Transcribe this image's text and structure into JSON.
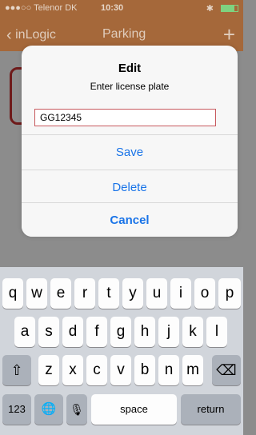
{
  "status_bar": {
    "carrier": "●●●○○ Telenor DK",
    "time": "10:30",
    "bluetooth": "bluetooth-icon",
    "battery": "battery-icon"
  },
  "nav": {
    "back_label": "inLogic",
    "title": "Parking",
    "add_label": "+"
  },
  "alert": {
    "title": "Edit",
    "message": "Enter license plate",
    "input_value": "GG12345",
    "buttons": {
      "save": "Save",
      "delete": "Delete",
      "cancel": "Cancel"
    }
  },
  "keyboard": {
    "row1": [
      "q",
      "w",
      "e",
      "r",
      "t",
      "y",
      "u",
      "i",
      "o",
      "p"
    ],
    "row2": [
      "a",
      "s",
      "d",
      "f",
      "g",
      "h",
      "j",
      "k",
      "l"
    ],
    "row3": [
      "z",
      "x",
      "c",
      "v",
      "b",
      "n",
      "m"
    ],
    "shift": "⇧",
    "backspace": "⌫",
    "numbers": "123",
    "globe": "🌐",
    "mic": "🎙",
    "space": "space",
    "return": "return"
  },
  "colors": {
    "accent_blue": "#1a74e8",
    "nav_bg_dimmed": "#a5683a",
    "input_border": "#c7585d"
  }
}
